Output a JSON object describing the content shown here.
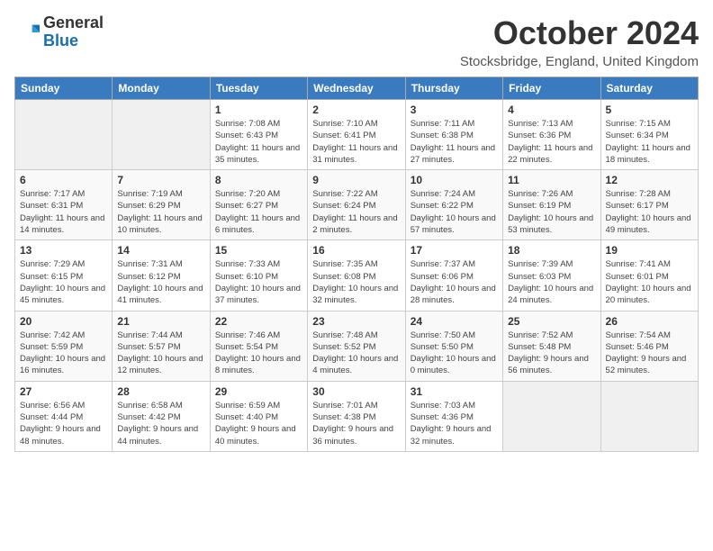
{
  "logo": {
    "general": "General",
    "blue": "Blue"
  },
  "header": {
    "month": "October 2024",
    "location": "Stocksbridge, England, United Kingdom"
  },
  "days_of_week": [
    "Sunday",
    "Monday",
    "Tuesday",
    "Wednesday",
    "Thursday",
    "Friday",
    "Saturday"
  ],
  "weeks": [
    [
      {
        "day": "",
        "info": ""
      },
      {
        "day": "",
        "info": ""
      },
      {
        "day": "1",
        "info": "Sunrise: 7:08 AM\nSunset: 6:43 PM\nDaylight: 11 hours and 35 minutes."
      },
      {
        "day": "2",
        "info": "Sunrise: 7:10 AM\nSunset: 6:41 PM\nDaylight: 11 hours and 31 minutes."
      },
      {
        "day": "3",
        "info": "Sunrise: 7:11 AM\nSunset: 6:38 PM\nDaylight: 11 hours and 27 minutes."
      },
      {
        "day": "4",
        "info": "Sunrise: 7:13 AM\nSunset: 6:36 PM\nDaylight: 11 hours and 22 minutes."
      },
      {
        "day": "5",
        "info": "Sunrise: 7:15 AM\nSunset: 6:34 PM\nDaylight: 11 hours and 18 minutes."
      }
    ],
    [
      {
        "day": "6",
        "info": "Sunrise: 7:17 AM\nSunset: 6:31 PM\nDaylight: 11 hours and 14 minutes."
      },
      {
        "day": "7",
        "info": "Sunrise: 7:19 AM\nSunset: 6:29 PM\nDaylight: 11 hours and 10 minutes."
      },
      {
        "day": "8",
        "info": "Sunrise: 7:20 AM\nSunset: 6:27 PM\nDaylight: 11 hours and 6 minutes."
      },
      {
        "day": "9",
        "info": "Sunrise: 7:22 AM\nSunset: 6:24 PM\nDaylight: 11 hours and 2 minutes."
      },
      {
        "day": "10",
        "info": "Sunrise: 7:24 AM\nSunset: 6:22 PM\nDaylight: 10 hours and 57 minutes."
      },
      {
        "day": "11",
        "info": "Sunrise: 7:26 AM\nSunset: 6:19 PM\nDaylight: 10 hours and 53 minutes."
      },
      {
        "day": "12",
        "info": "Sunrise: 7:28 AM\nSunset: 6:17 PM\nDaylight: 10 hours and 49 minutes."
      }
    ],
    [
      {
        "day": "13",
        "info": "Sunrise: 7:29 AM\nSunset: 6:15 PM\nDaylight: 10 hours and 45 minutes."
      },
      {
        "day": "14",
        "info": "Sunrise: 7:31 AM\nSunset: 6:12 PM\nDaylight: 10 hours and 41 minutes."
      },
      {
        "day": "15",
        "info": "Sunrise: 7:33 AM\nSunset: 6:10 PM\nDaylight: 10 hours and 37 minutes."
      },
      {
        "day": "16",
        "info": "Sunrise: 7:35 AM\nSunset: 6:08 PM\nDaylight: 10 hours and 32 minutes."
      },
      {
        "day": "17",
        "info": "Sunrise: 7:37 AM\nSunset: 6:06 PM\nDaylight: 10 hours and 28 minutes."
      },
      {
        "day": "18",
        "info": "Sunrise: 7:39 AM\nSunset: 6:03 PM\nDaylight: 10 hours and 24 minutes."
      },
      {
        "day": "19",
        "info": "Sunrise: 7:41 AM\nSunset: 6:01 PM\nDaylight: 10 hours and 20 minutes."
      }
    ],
    [
      {
        "day": "20",
        "info": "Sunrise: 7:42 AM\nSunset: 5:59 PM\nDaylight: 10 hours and 16 minutes."
      },
      {
        "day": "21",
        "info": "Sunrise: 7:44 AM\nSunset: 5:57 PM\nDaylight: 10 hours and 12 minutes."
      },
      {
        "day": "22",
        "info": "Sunrise: 7:46 AM\nSunset: 5:54 PM\nDaylight: 10 hours and 8 minutes."
      },
      {
        "day": "23",
        "info": "Sunrise: 7:48 AM\nSunset: 5:52 PM\nDaylight: 10 hours and 4 minutes."
      },
      {
        "day": "24",
        "info": "Sunrise: 7:50 AM\nSunset: 5:50 PM\nDaylight: 10 hours and 0 minutes."
      },
      {
        "day": "25",
        "info": "Sunrise: 7:52 AM\nSunset: 5:48 PM\nDaylight: 9 hours and 56 minutes."
      },
      {
        "day": "26",
        "info": "Sunrise: 7:54 AM\nSunset: 5:46 PM\nDaylight: 9 hours and 52 minutes."
      }
    ],
    [
      {
        "day": "27",
        "info": "Sunrise: 6:56 AM\nSunset: 4:44 PM\nDaylight: 9 hours and 48 minutes."
      },
      {
        "day": "28",
        "info": "Sunrise: 6:58 AM\nSunset: 4:42 PM\nDaylight: 9 hours and 44 minutes."
      },
      {
        "day": "29",
        "info": "Sunrise: 6:59 AM\nSunset: 4:40 PM\nDaylight: 9 hours and 40 minutes."
      },
      {
        "day": "30",
        "info": "Sunrise: 7:01 AM\nSunset: 4:38 PM\nDaylight: 9 hours and 36 minutes."
      },
      {
        "day": "31",
        "info": "Sunrise: 7:03 AM\nSunset: 4:36 PM\nDaylight: 9 hours and 32 minutes."
      },
      {
        "day": "",
        "info": ""
      },
      {
        "day": "",
        "info": ""
      }
    ]
  ]
}
